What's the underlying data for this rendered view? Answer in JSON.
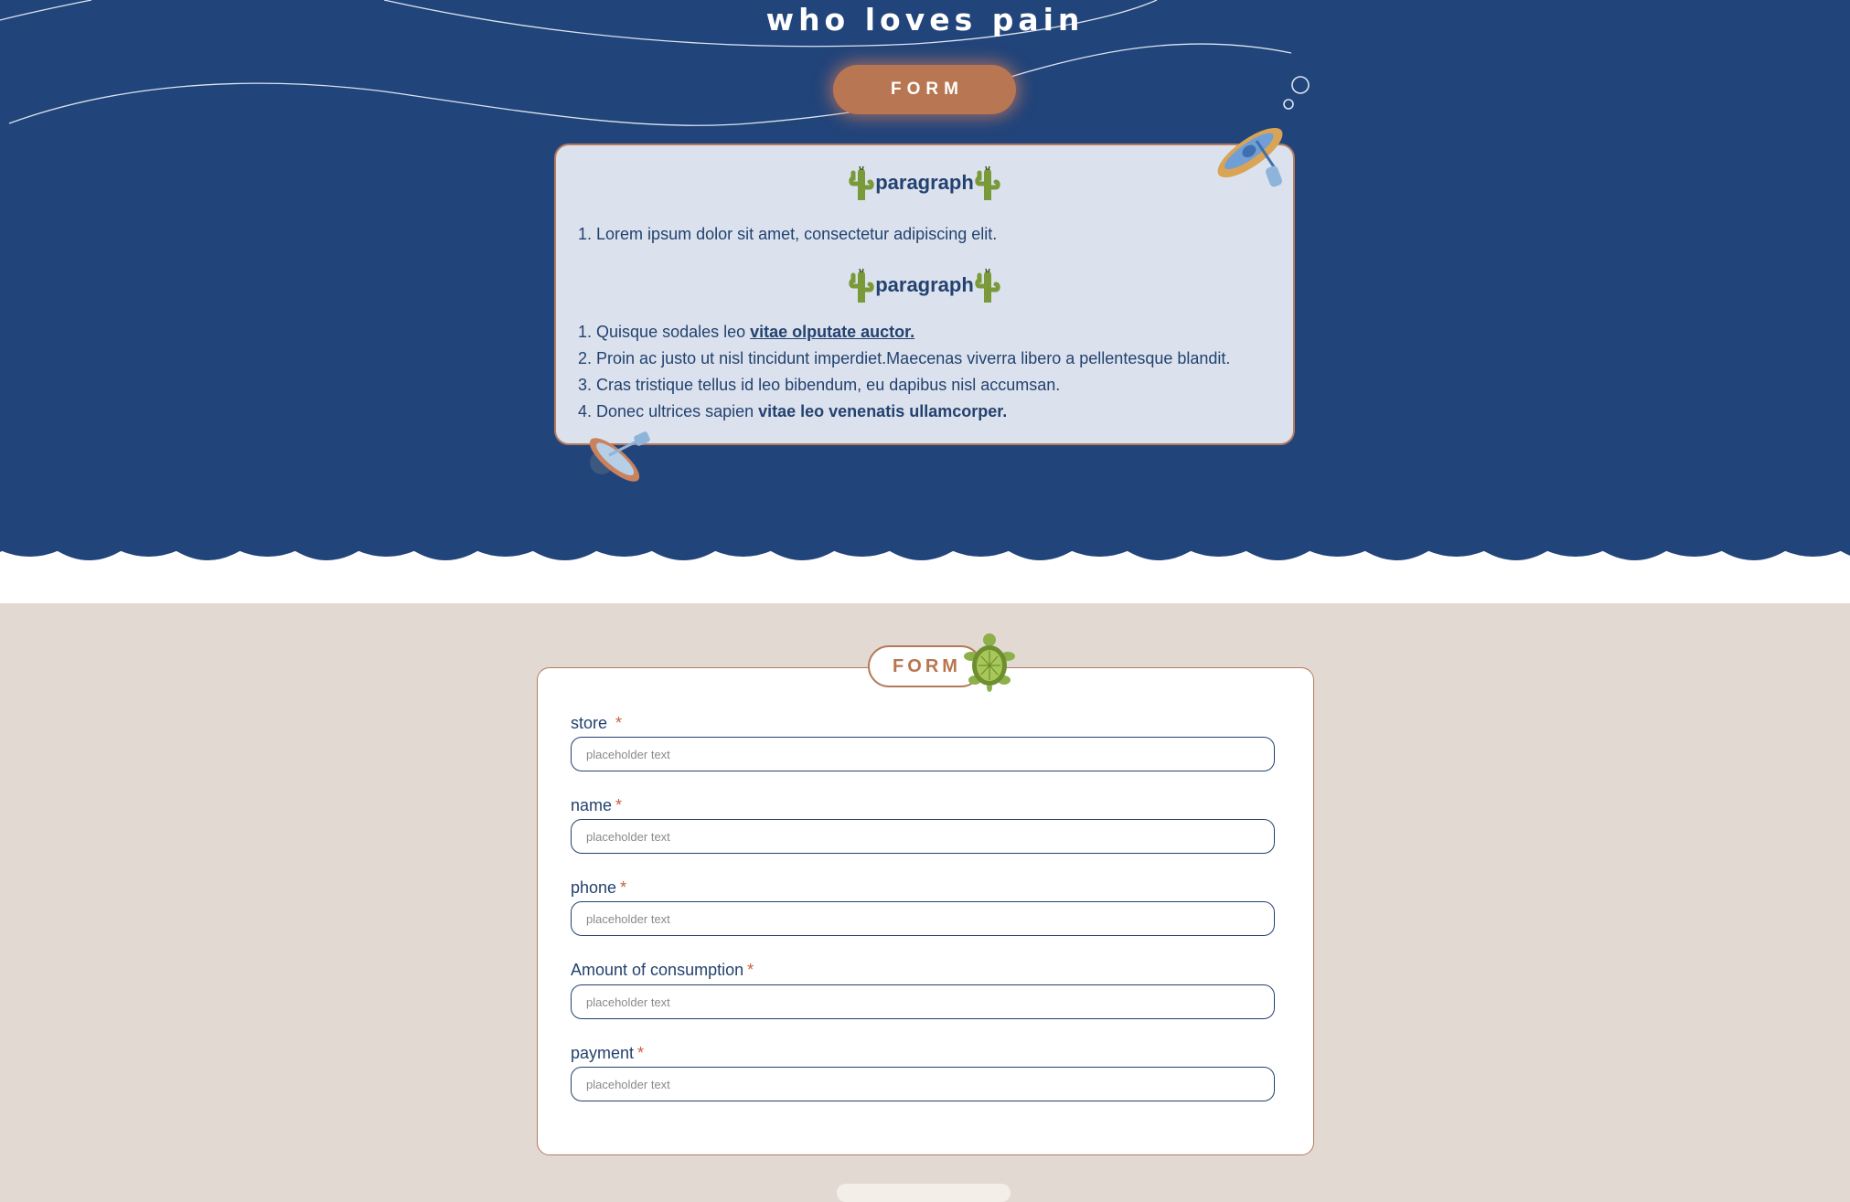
{
  "header": {
    "title": "who loves pain",
    "form_button_label": "FORM"
  },
  "info_card": {
    "sections": [
      {
        "heading": "paragraph",
        "items": [
          {
            "number": "1.",
            "text": "Lorem ipsum dolor sit amet, consectetur adipiscing elit.",
            "emphasis": ""
          }
        ]
      },
      {
        "heading": "paragraph",
        "items": [
          {
            "number": "1.",
            "text": "Quisque sodales leo ",
            "emphasis": "vitae olputate auctor."
          },
          {
            "number": "2.",
            "text": "Proin ac justo ut nisl tincidunt imperdiet.Maecenas viverra libero a pellentesque blandit.",
            "emphasis": ""
          },
          {
            "number": "3.",
            "text": "Cras tristique tellus id leo bibendum, eu dapibus nisl accumsan.",
            "emphasis": ""
          },
          {
            "number": "4.",
            "text": "Donec ultrices sapien ",
            "emphasis": "vitae leo venenatis ullamcorper."
          }
        ]
      }
    ]
  },
  "form": {
    "tag_label": "FORM",
    "required_marker": "*",
    "fields": [
      {
        "label": "store",
        "placeholder": "placeholder text",
        "value": ""
      },
      {
        "label": "name",
        "placeholder": "placeholder text",
        "value": ""
      },
      {
        "label": "phone",
        "placeholder": "placeholder text",
        "value": ""
      },
      {
        "label": "Amount of consumption",
        "placeholder": "placeholder text",
        "value": ""
      },
      {
        "label": "payment",
        "placeholder": "placeholder text",
        "value": ""
      }
    ]
  },
  "colors": {
    "navy": "#21447a",
    "sand": "#e2d9d2",
    "terracotta": "#b87652",
    "card_bg": "#dbe2ee",
    "cactus_green": "#7a9a3a",
    "turtle_green": "#8db04a"
  },
  "icons": [
    "cactus-icon",
    "canoe-icon",
    "bubble-icon",
    "turtle-icon"
  ]
}
